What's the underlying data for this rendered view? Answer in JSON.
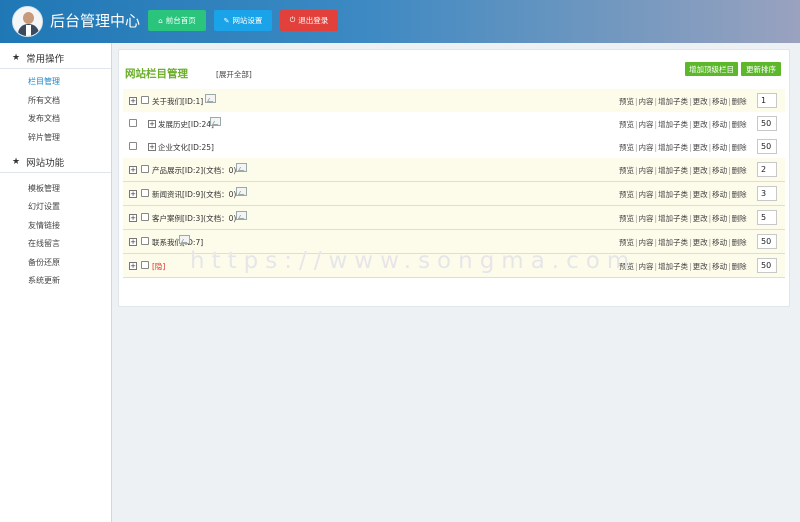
{
  "header": {
    "title": "后台管理中心",
    "buttons": [
      {
        "label": "前台首页",
        "icon": "home-icon"
      },
      {
        "label": "网站设置",
        "icon": "wrench-icon"
      },
      {
        "label": "退出登录",
        "icon": "power-icon"
      }
    ]
  },
  "sidebar": {
    "sections": [
      {
        "title": "常用操作",
        "items": [
          "栏目管理",
          "所有文档",
          "发布文档",
          "碎片管理"
        ],
        "active": "栏目管理"
      },
      {
        "title": "网站功能",
        "items": [
          "模板管理",
          "幻灯设置",
          "友情链接",
          "在线留言",
          "备份还原",
          "系统更新"
        ]
      }
    ]
  },
  "panel": {
    "title": "网站栏目管理",
    "expand_all": "[展开全部]",
    "add_top_button": "增加顶级栏目",
    "update_sort_button": "更新排序",
    "actions": [
      "预览",
      "内容",
      "增加子类",
      "更改",
      "移动",
      "删除"
    ],
    "rows": [
      {
        "name": "关于我们[ID:1]",
        "order": "1",
        "level": 0
      },
      {
        "name": "发展历史[ID:24]",
        "order": "50",
        "level": 1
      },
      {
        "name": "企业文化[ID:25]",
        "order": "50",
        "level": 1
      },
      {
        "name": "产品展示[ID:2](文档：0)",
        "order": "2",
        "level": 0
      },
      {
        "name": "新闻资讯[ID:9](文档：0)",
        "order": "3",
        "level": 0
      },
      {
        "name": "客户案例[ID:3](文档：0)",
        "order": "5",
        "level": 0
      },
      {
        "name": "联系我们[ID:7]",
        "order": "50",
        "level": 0
      },
      {
        "name": "[隐]",
        "order": "50",
        "level": 0
      }
    ]
  },
  "watermark": "https://www.songma.com",
  "colors": {
    "accent_green": "#5cb82a",
    "title_green": "#6cae2c",
    "link_blue": "#1b86c7"
  }
}
